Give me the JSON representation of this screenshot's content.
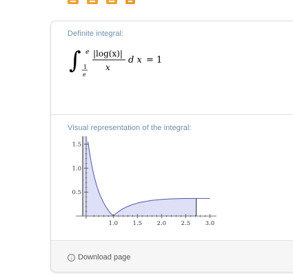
{
  "toolbar": {
    "icons": [
      "keyboard-icon",
      "camera-icon",
      "table-icon",
      "puzzle-icon"
    ],
    "accent_color": "#f0a030"
  },
  "integral_section": {
    "title": "Definite integral:",
    "integral_sign": "∫",
    "upper_limit": "e",
    "lower_numerator": "1",
    "lower_denominator": "e",
    "integrand_numerator": "|log(x)|",
    "integrand_denominator": "x",
    "differential": "d x",
    "result": "= 1"
  },
  "visual_section": {
    "title": "Visual representation of the integral:"
  },
  "footer": {
    "download_label": "Download page"
  },
  "chart_data": {
    "type": "area",
    "function": "|log(x)|/x",
    "x": [
      0.3679,
      0.4,
      0.45,
      0.5,
      0.55,
      0.6,
      0.65,
      0.7,
      0.75,
      0.8,
      0.85,
      0.9,
      0.95,
      1.0,
      1.1,
      1.2,
      1.3,
      1.4,
      1.5,
      1.6,
      1.8,
      2.0,
      2.2,
      2.4,
      2.6,
      2.7183
    ],
    "y": [
      2.718,
      2.291,
      1.775,
      1.386,
      1.087,
      0.851,
      0.663,
      0.51,
      0.384,
      0.279,
      0.191,
      0.117,
      0.054,
      0.0,
      0.087,
      0.152,
      0.202,
      0.24,
      0.27,
      0.294,
      0.327,
      0.347,
      0.358,
      0.365,
      0.368,
      0.368
    ],
    "fill_from": 0.3679,
    "fill_to": 2.7183,
    "curve_extends_to": 3.0,
    "xlim": [
      0.25,
      3.08
    ],
    "ylim": [
      0,
      1.55
    ],
    "x_ticks": [
      "1.0",
      "1.5",
      "2.0",
      "2.5",
      "3.0"
    ],
    "y_ticks": [
      "0.5",
      "1.0",
      "1.5"
    ],
    "fill_color": "#dde0f6",
    "line_color": "#4d55a8"
  }
}
